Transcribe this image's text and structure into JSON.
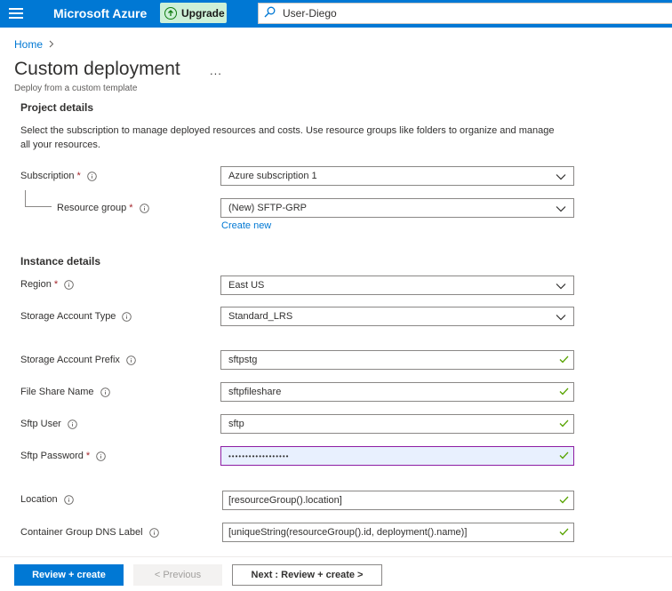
{
  "topbar": {
    "brand": "Microsoft Azure",
    "upgrade_label": "Upgrade",
    "search_text": "User-Diego",
    "accent_color": "#0078d4"
  },
  "breadcrumb": {
    "home": "Home"
  },
  "page": {
    "title": "Custom deployment",
    "more": "...",
    "subtitle": "Deploy from a custom template"
  },
  "project": {
    "heading": "Project details",
    "description": "Select the subscription to manage deployed resources and costs. Use resource groups like folders to organize and manage all your resources.",
    "subscription": {
      "label": "Subscription",
      "required": "*",
      "value": "Azure subscription 1"
    },
    "resource_group": {
      "label": "Resource group",
      "required": "*",
      "value": "(New) SFTP-GRP",
      "create_new": "Create new"
    }
  },
  "instance": {
    "heading": "Instance details",
    "region": {
      "label": "Region",
      "required": "*",
      "value": "East US"
    },
    "storage_type": {
      "label": "Storage Account Type",
      "value": "Standard_LRS"
    },
    "storage_prefix": {
      "label": "Storage Account Prefix",
      "value": "sftpstg"
    },
    "file_share": {
      "label": "File Share Name",
      "value": "sftpfileshare"
    },
    "sftp_user": {
      "label": "Sftp User",
      "value": "sftp"
    },
    "sftp_password": {
      "label": "Sftp Password",
      "required": "*",
      "value": "••••••••••••••••••"
    },
    "location": {
      "label": "Location",
      "value": "[resourceGroup().location]"
    },
    "dns_label": {
      "label": "Container Group DNS Label",
      "value": "[uniqueString(resourceGroup().id, deployment().name)]"
    }
  },
  "footer": {
    "review_create": "Review + create",
    "previous": "< Previous",
    "next": "Next : Review + create >"
  }
}
